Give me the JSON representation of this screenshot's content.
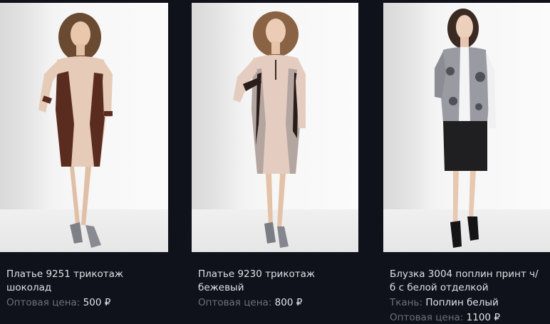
{
  "products": [
    {
      "title": "Платье 9251 трикотаж шоколад",
      "price_label": "Оптовая цена:",
      "price_value": "500",
      "currency": "₽"
    },
    {
      "title": "Платье 9230 трикотаж бежевый",
      "price_label": "Оптовая цена:",
      "price_value": "800",
      "currency": "₽"
    },
    {
      "title": "Блузка 3004 поплин принт ч/б с белой отделкой",
      "fabric_label": "Ткань:",
      "fabric_value": "Поплин белый",
      "price_label": "Оптовая цена:",
      "price_value": "1100",
      "currency": "₽"
    }
  ],
  "colors": {
    "background": "#0f121a",
    "title_text": "#dfe1e6",
    "label_text": "#6b707b",
    "value_text": "#e2e4e8"
  }
}
